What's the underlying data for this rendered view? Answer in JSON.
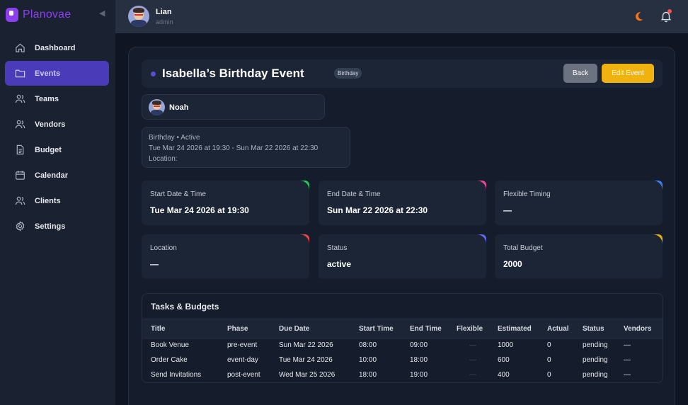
{
  "brand": {
    "name": "Planovae"
  },
  "sidebar": {
    "items": [
      {
        "label": "Dashboard",
        "icon": "home-icon"
      },
      {
        "label": "Events",
        "icon": "folder-icon",
        "active": true
      },
      {
        "label": "Teams",
        "icon": "users-icon"
      },
      {
        "label": "Vendors",
        "icon": "users-icon"
      },
      {
        "label": "Budget",
        "icon": "document-icon"
      },
      {
        "label": "Calendar",
        "icon": "calendar-icon"
      },
      {
        "label": "Clients",
        "icon": "users-icon"
      },
      {
        "label": "Settings",
        "icon": "gear-icon"
      }
    ]
  },
  "header": {
    "user_name": "Lian",
    "user_role": "admin"
  },
  "event": {
    "title": "Isabella’s Birthday Event",
    "badge": "Birthday",
    "back_label": "Back",
    "edit_label": "Edit Event",
    "member_name": "Noah",
    "summary": {
      "line1": "Birthday • Active",
      "line2": "Tue Mar 24 2026 at 19:30 - Sun Mar 22 2026 at 22:30",
      "line3": "Location:"
    }
  },
  "stats": [
    {
      "label": "Start Date & Time",
      "value": "Tue Mar 24 2026 at 19:30",
      "accent": "#22c55e"
    },
    {
      "label": "End Date & Time",
      "value": "Sun Mar 22 2026 at 22:30",
      "accent": "#ec4899"
    },
    {
      "label": "Flexible Timing",
      "value": "—",
      "accent": "#3b82f6"
    },
    {
      "label": "Location",
      "value": "—",
      "accent": "#ef4444"
    },
    {
      "label": "Status",
      "value": "active",
      "accent": "#6366f1"
    },
    {
      "label": "Total Budget",
      "value": "2000",
      "accent": "#eab308"
    }
  ],
  "tasks": {
    "title": "Tasks & Budgets",
    "columns": [
      "Title",
      "Phase",
      "Due Date",
      "Start Time",
      "End Time",
      "Flexible",
      "Estimated",
      "Actual",
      "Status",
      "Vendors"
    ],
    "rows": [
      [
        "Book Venue",
        "pre-event",
        "Sun Mar 22 2026",
        "08:00",
        "09:00",
        "—",
        "1000",
        "0",
        "pending",
        "—"
      ],
      [
        "Order Cake",
        "event-day",
        "Tue Mar 24 2026",
        "10:00",
        "18:00",
        "—",
        "600",
        "0",
        "pending",
        "—"
      ],
      [
        "Send Invitations",
        "post-event",
        "Wed Mar 25 2026",
        "18:00",
        "19:00",
        "—",
        "400",
        "0",
        "pending",
        "—"
      ]
    ]
  }
}
